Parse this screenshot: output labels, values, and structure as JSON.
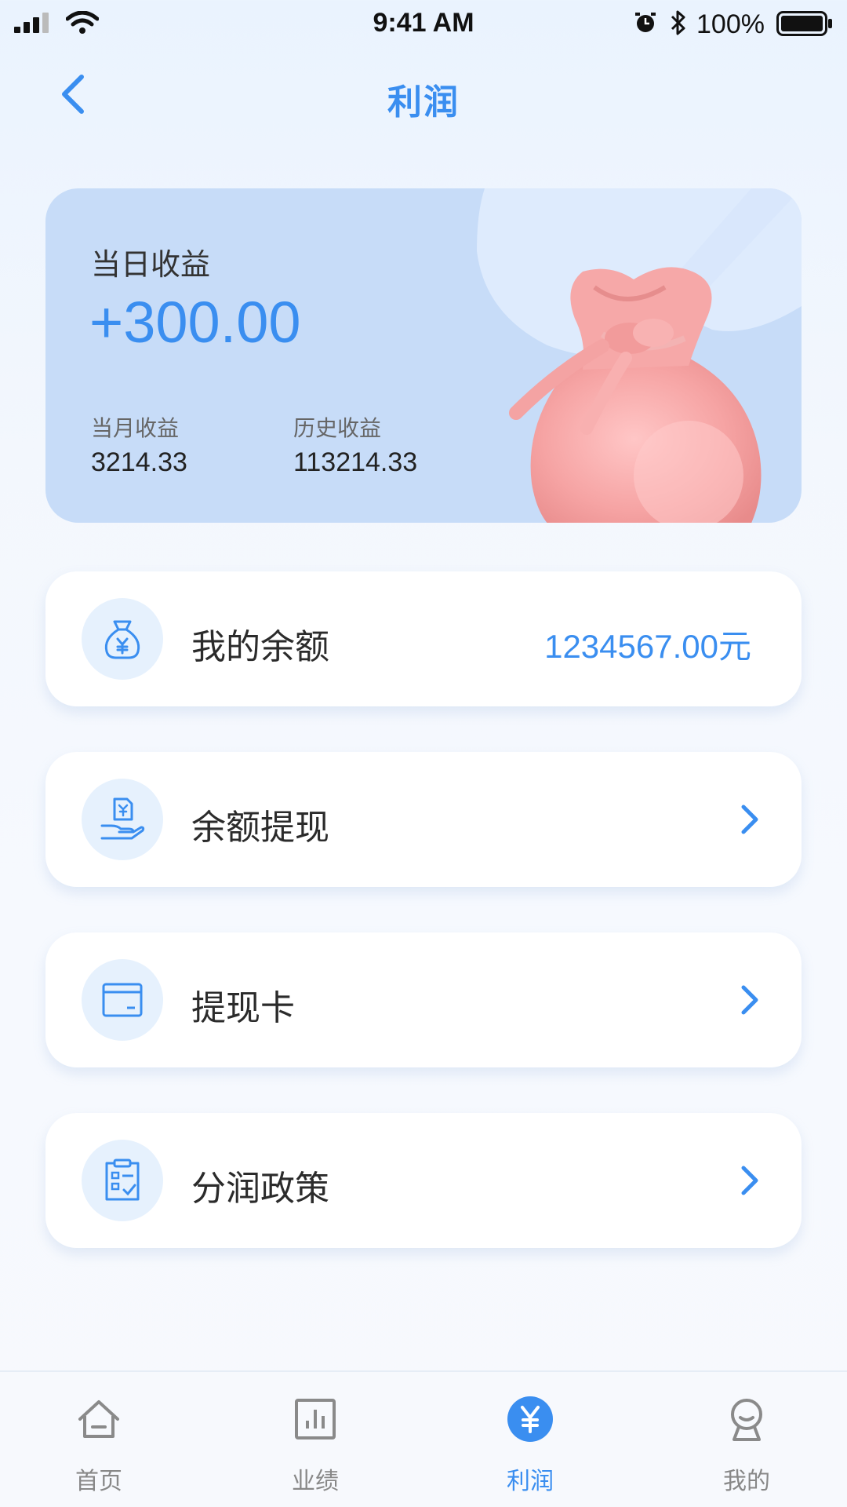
{
  "status_bar": {
    "time": "9:41 AM",
    "battery": "100%"
  },
  "nav": {
    "title": "利润",
    "back_icon": "chevron-left-icon"
  },
  "profit_card": {
    "today_label": "当日收益",
    "today_value": "+300.00",
    "month_label": "当月收益",
    "month_value": "3214.33",
    "history_label": "历史收益",
    "history_value": "113214.33",
    "illustration": "money-bag"
  },
  "rows": [
    {
      "label": "我的余额",
      "value": "1234567.00元",
      "icon": "money-bag-icon"
    },
    {
      "label": "余额提现",
      "icon": "withdraw-hand-icon"
    },
    {
      "label": "提现卡",
      "icon": "card-icon"
    },
    {
      "label": "分润政策",
      "icon": "clipboard-icon"
    }
  ],
  "tabs": [
    {
      "label": "首页",
      "icon": "home-icon",
      "active": false
    },
    {
      "label": "业绩",
      "icon": "chart-icon",
      "active": false
    },
    {
      "label": "利润",
      "icon": "yen-icon",
      "active": true
    },
    {
      "label": "我的",
      "icon": "user-icon",
      "active": false
    }
  ],
  "colors": {
    "accent": "#3a8ef0",
    "card_bg": "#c7dcf8",
    "bag": "#f4a3a3"
  }
}
